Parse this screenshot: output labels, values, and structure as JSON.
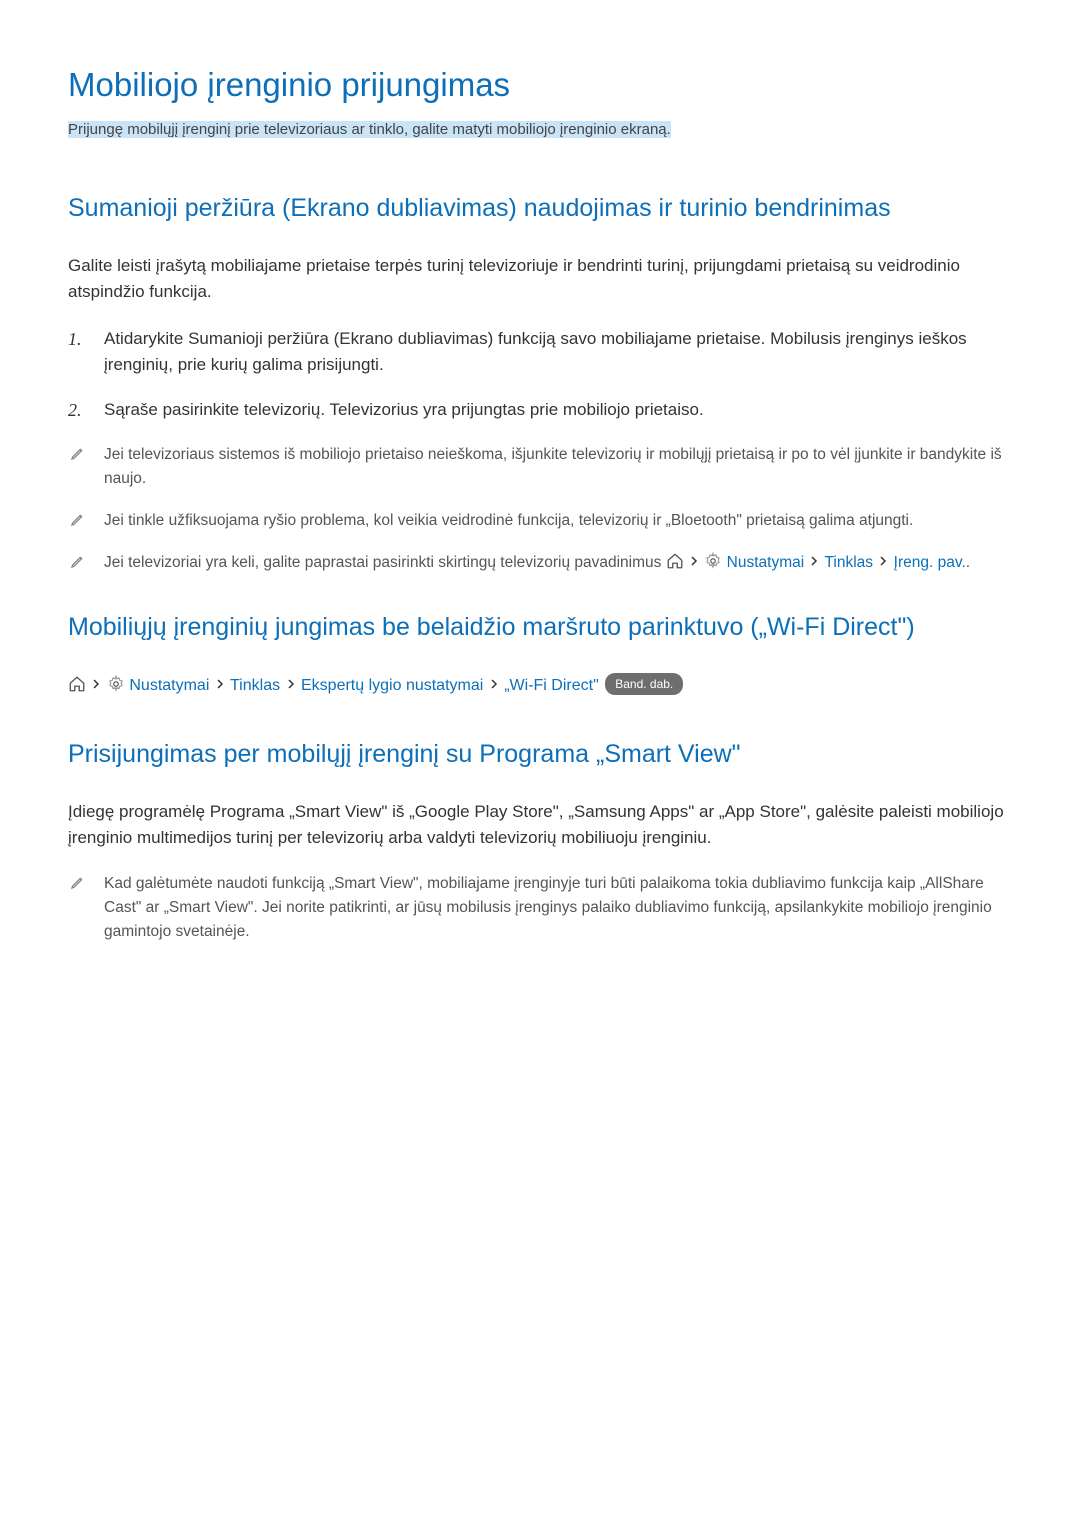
{
  "page": {
    "title": "Mobiliojo įrenginio prijungimas",
    "subtitle": "Prijungę mobilųjį įrenginį prie televizoriaus ar tinklo, galite matyti mobiliojo įrenginio ekraną."
  },
  "section1": {
    "heading": "Sumanioji peržiūra (Ekrano dubliavimas) naudojimas ir turinio bendrinimas",
    "intro": "Galite leisti įrašytą mobiliajame prietaise terpės turinį televizoriuje ir bendrinti turinį, prijungdami prietaisą su veidrodinio atspindžio funkcija.",
    "steps": [
      "Atidarykite Sumanioji peržiūra (Ekrano dubliavimas) funkciją savo mobiliajame prietaise. Mobilusis įrenginys ieškos įrenginių, prie kurių galima prisijungti.",
      "Sąraše pasirinkite televizorių. Televizorius yra prijungtas prie mobiliojo prietaiso."
    ],
    "step_nums": [
      "1.",
      "2."
    ],
    "notes": {
      "n1": "Jei televizoriaus sistemos iš mobiliojo prietaiso neieškoma, išjunkite televizorių ir mobilųjį prietaisą ir po to vėl įjunkite ir bandykite iš naujo.",
      "n2": "Jei tinkle užfiksuojama ryšio problema, kol veikia veidrodinė funkcija, televizorių ir „Bloetooth\" prietaisą galima atjungti."
    },
    "note3": {
      "prefix": "Jei televizoriai yra keli, galite paprastai pasirinkti skirtingų televizorių pavadinimus ",
      "link1": "Nustatymai",
      "link2": "Tinklas",
      "link3": "Įreng. pav.",
      "suffix": "."
    }
  },
  "section2": {
    "heading": "Mobiliųjų įrenginių jungimas be belaidžio maršruto parinktuvo („Wi-Fi Direct\")",
    "nav": {
      "p1": "Nustatymai",
      "p2": "Tinklas",
      "p3": "Ekspertų lygio nustatymai",
      "p4": "„Wi-Fi Direct\"",
      "badge": "Band. dab."
    }
  },
  "section3": {
    "heading": "Prisijungimas per mobilųjį įrenginį su Programa „Smart View\"",
    "intro": "Įdiegę programėlę Programa „Smart View\" iš „Google Play Store\", „Samsung Apps\" ar „App Store\", galėsite paleisti mobiliojo įrenginio multimedijos turinį per televizorių arba valdyti televizorių mobiliuoju įrenginiu.",
    "note": "Kad galėtumėte naudoti funkciją „Smart View\", mobiliajame įrenginyje turi būti palaikoma tokia dubliavimo funkcija kaip „AllShare Cast\" ar „Smart View\". Jei norite patikrinti, ar jūsų mobilusis įrenginys palaiko dubliavimo funkciją, apsilankykite mobiliojo įrenginio gamintojo svetainėje."
  }
}
